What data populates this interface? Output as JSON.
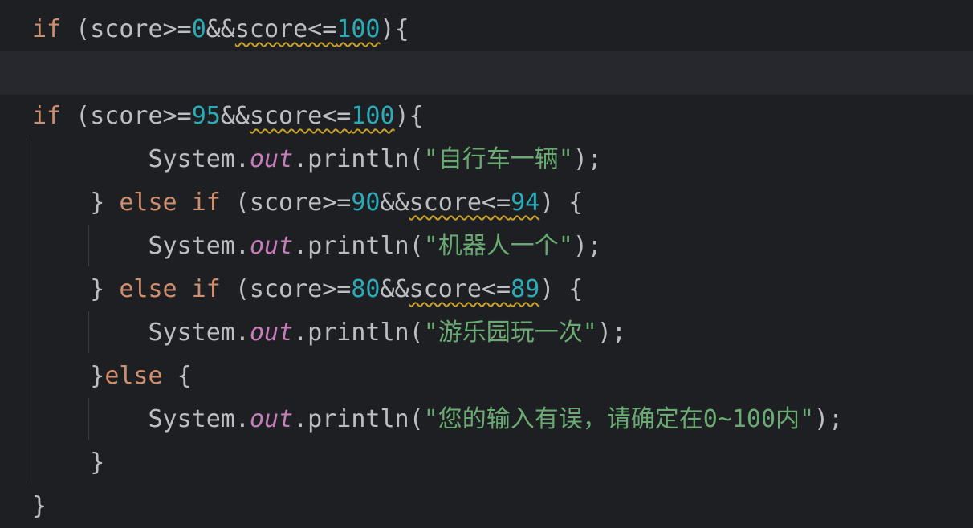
{
  "code_lines": [
    {
      "id": "l1",
      "tokens": [
        {
          "t": "if",
          "c": "kw"
        },
        {
          "t": " (score>=",
          "c": "plain"
        },
        {
          "t": "0",
          "c": "num"
        },
        {
          "t": "&&",
          "c": "plain"
        },
        {
          "t": "score<=",
          "c": "plain",
          "w": true
        },
        {
          "t": "100",
          "c": "num",
          "w": true
        },
        {
          "t": "){",
          "c": "plain"
        }
      ]
    },
    {
      "id": "l2",
      "tokens": []
    },
    {
      "id": "l3",
      "tokens": [
        {
          "t": "if",
          "c": "kw"
        },
        {
          "t": " (score>=",
          "c": "plain"
        },
        {
          "t": "95",
          "c": "num"
        },
        {
          "t": "&&",
          "c": "plain"
        },
        {
          "t": "score<=",
          "c": "plain",
          "w": true
        },
        {
          "t": "100",
          "c": "num",
          "w": true
        },
        {
          "t": "){",
          "c": "plain"
        }
      ]
    },
    {
      "id": "l4",
      "tokens": [
        {
          "t": "        System.",
          "c": "plain"
        },
        {
          "t": "out",
          "c": "fld"
        },
        {
          "t": ".println(",
          "c": "plain"
        },
        {
          "t": "\"自行车一辆\"",
          "c": "str"
        },
        {
          "t": ");",
          "c": "plain"
        }
      ]
    },
    {
      "id": "l5",
      "tokens": [
        {
          "t": "    } ",
          "c": "plain"
        },
        {
          "t": "else if",
          "c": "kw"
        },
        {
          "t": " (score>=",
          "c": "plain"
        },
        {
          "t": "90",
          "c": "num"
        },
        {
          "t": "&&",
          "c": "plain"
        },
        {
          "t": "score<=",
          "c": "plain",
          "w": true
        },
        {
          "t": "94",
          "c": "num",
          "w": true
        },
        {
          "t": ") {",
          "c": "plain"
        }
      ]
    },
    {
      "id": "l6",
      "tokens": [
        {
          "t": "        System.",
          "c": "plain"
        },
        {
          "t": "out",
          "c": "fld"
        },
        {
          "t": ".println(",
          "c": "plain"
        },
        {
          "t": "\"机器人一个\"",
          "c": "str"
        },
        {
          "t": ");",
          "c": "plain"
        }
      ]
    },
    {
      "id": "l7",
      "tokens": [
        {
          "t": "    } ",
          "c": "plain"
        },
        {
          "t": "else if",
          "c": "kw"
        },
        {
          "t": " (score>=",
          "c": "plain"
        },
        {
          "t": "80",
          "c": "num"
        },
        {
          "t": "&&",
          "c": "plain"
        },
        {
          "t": "score<=",
          "c": "plain",
          "w": true
        },
        {
          "t": "89",
          "c": "num",
          "w": true
        },
        {
          "t": ") {",
          "c": "plain"
        }
      ]
    },
    {
      "id": "l8",
      "tokens": [
        {
          "t": "        System.",
          "c": "plain"
        },
        {
          "t": "out",
          "c": "fld"
        },
        {
          "t": ".println(",
          "c": "plain"
        },
        {
          "t": "\"游乐园玩一次\"",
          "c": "str"
        },
        {
          "t": ");",
          "c": "plain"
        }
      ]
    },
    {
      "id": "l9",
      "tokens": [
        {
          "t": "    }",
          "c": "plain"
        },
        {
          "t": "else",
          "c": "kw"
        },
        {
          "t": " {",
          "c": "plain"
        }
      ]
    },
    {
      "id": "l10",
      "tokens": [
        {
          "t": "        System.",
          "c": "plain"
        },
        {
          "t": "out",
          "c": "fld"
        },
        {
          "t": ".println(",
          "c": "plain"
        },
        {
          "t": "\"您的输入有误，请确定在0~100内\"",
          "c": "str"
        },
        {
          "t": ");",
          "c": "plain"
        }
      ]
    },
    {
      "id": "l11",
      "tokens": [
        {
          "t": "    }",
          "c": "plain"
        }
      ]
    },
    {
      "id": "l12",
      "tokens": [
        {
          "t": "}",
          "c": "plain"
        }
      ]
    }
  ],
  "colors": {
    "background": "#1e1f22",
    "current_line": "#26282e",
    "keyword": "#cf8e6d",
    "number": "#2aacb8",
    "string": "#6aab73",
    "field": "#c77dbb",
    "text": "#bcbec4",
    "warning_squiggle": "#c9a227"
  }
}
